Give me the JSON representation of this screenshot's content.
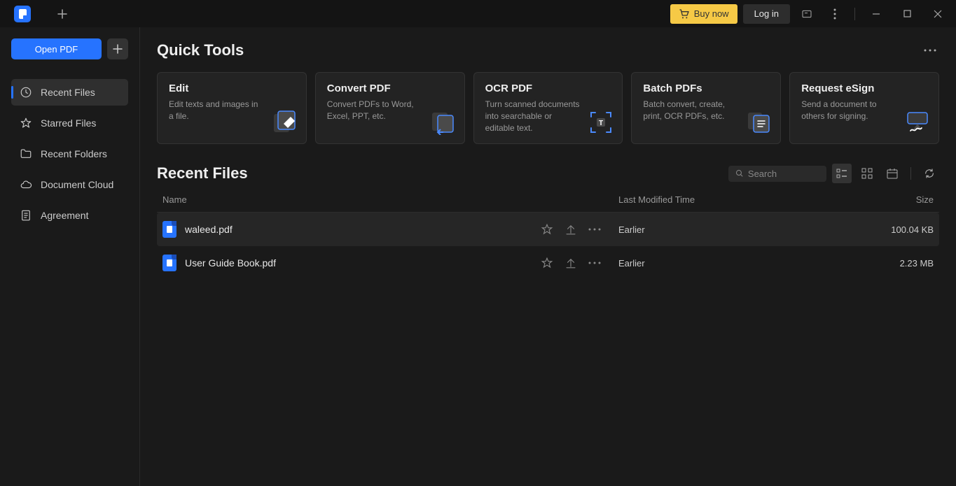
{
  "titlebar": {
    "buy_label": "Buy now",
    "login_label": "Log in"
  },
  "sidebar": {
    "open_label": "Open PDF",
    "items": [
      {
        "label": "Recent Files"
      },
      {
        "label": "Starred Files"
      },
      {
        "label": "Recent Folders"
      },
      {
        "label": "Document Cloud"
      },
      {
        "label": "Agreement"
      }
    ]
  },
  "quick_tools": {
    "title": "Quick Tools",
    "cards": [
      {
        "title": "Edit",
        "desc": "Edit texts and images in a file."
      },
      {
        "title": "Convert PDF",
        "desc": "Convert PDFs to Word, Excel, PPT, etc."
      },
      {
        "title": "OCR PDF",
        "desc": "Turn scanned documents into searchable or editable text."
      },
      {
        "title": "Batch PDFs",
        "desc": "Batch convert, create, print, OCR PDFs, etc."
      },
      {
        "title": "Request eSign",
        "desc": "Send a document to others for signing."
      }
    ]
  },
  "recent": {
    "title": "Recent Files",
    "search_placeholder": "Search",
    "columns": {
      "name": "Name",
      "time": "Last Modified Time",
      "size": "Size"
    },
    "files": [
      {
        "name": "waleed.pdf",
        "time": "Earlier",
        "size": "100.04 KB"
      },
      {
        "name": "User Guide Book.pdf",
        "time": "Earlier",
        "size": "2.23 MB"
      }
    ]
  }
}
